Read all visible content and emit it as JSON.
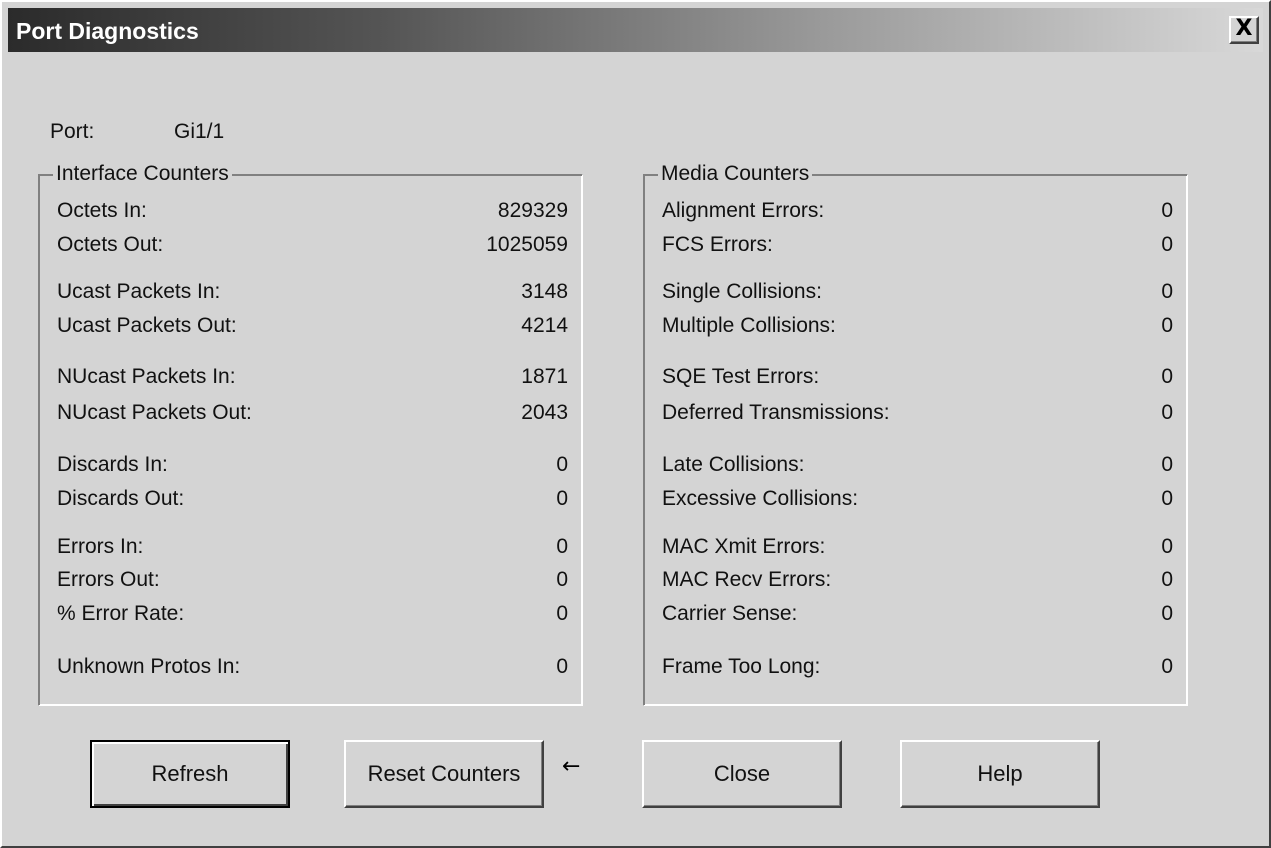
{
  "window": {
    "title": "Port Diagnostics",
    "close_glyph": "X"
  },
  "port": {
    "label": "Port:",
    "value": "Gi1/1"
  },
  "interface_counters": {
    "title": "Interface Counters",
    "rows": [
      {
        "label": "Octets In:",
        "value": "829329"
      },
      {
        "label": "Octets Out:",
        "value": "1025059"
      },
      {
        "label": "Ucast Packets In:",
        "value": "3148"
      },
      {
        "label": "Ucast Packets Out:",
        "value": "4214"
      },
      {
        "label": "NUcast Packets In:",
        "value": "1871"
      },
      {
        "label": "NUcast Packets Out:",
        "value": "2043"
      },
      {
        "label": "Discards In:",
        "value": "0"
      },
      {
        "label": "Discards Out:",
        "value": "0"
      },
      {
        "label": "Errors In:",
        "value": "0"
      },
      {
        "label": "Errors Out:",
        "value": "0"
      },
      {
        "label": "% Error Rate:",
        "value": "0"
      },
      {
        "label": "Unknown Protos In:",
        "value": "0"
      }
    ]
  },
  "media_counters": {
    "title": "Media Counters",
    "rows": [
      {
        "label": "Alignment Errors:",
        "value": "0"
      },
      {
        "label": "FCS Errors:",
        "value": "0"
      },
      {
        "label": "Single Collisions:",
        "value": "0"
      },
      {
        "label": "Multiple Collisions:",
        "value": "0"
      },
      {
        "label": "SQE Test Errors:",
        "value": "0"
      },
      {
        "label": "Deferred Transmissions:",
        "value": "0"
      },
      {
        "label": "Late Collisions:",
        "value": "0"
      },
      {
        "label": "Excessive Collisions:",
        "value": "0"
      },
      {
        "label": "MAC Xmit Errors:",
        "value": "0"
      },
      {
        "label": "MAC Recv Errors:",
        "value": "0"
      },
      {
        "label": "Carrier Sense:",
        "value": "0"
      },
      {
        "label": "Frame Too Long:",
        "value": "0"
      }
    ]
  },
  "buttons": {
    "refresh": "Refresh",
    "reset_counters": "Reset Counters",
    "close": "Close",
    "help": "Help"
  },
  "icons": {
    "arrow": "left-arrow-icon"
  }
}
